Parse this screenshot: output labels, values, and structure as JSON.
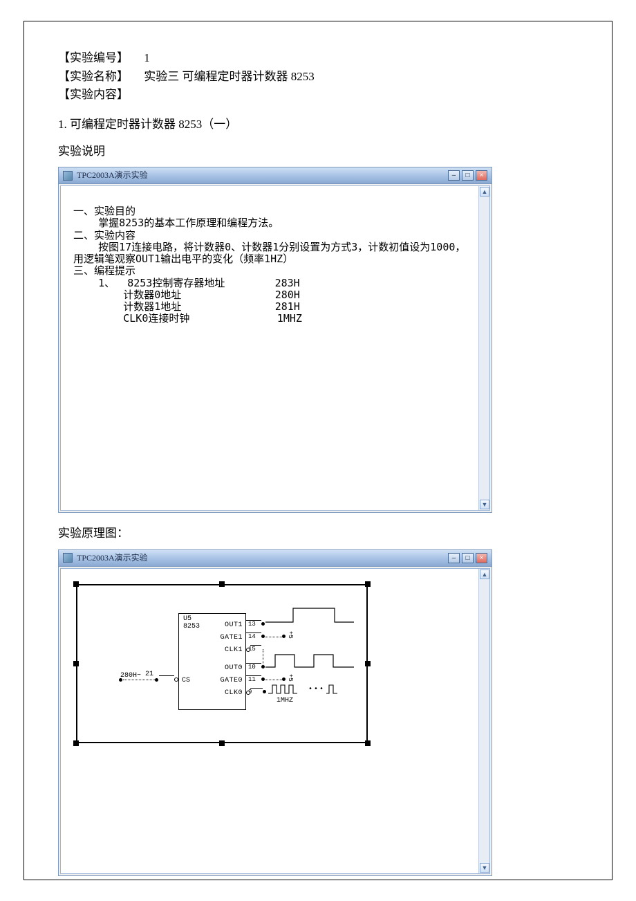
{
  "header": {
    "id_label": "【实验编号】",
    "id_value": "1",
    "name_label": "【实验名称】",
    "name_value": "实验三  可编程定时器计数器 8253",
    "content_label": "【实验内容】"
  },
  "section1_title": "1. 可编程定时器计数器 8253（一）",
  "desc_label": "实验说明",
  "win1": {
    "title": "TPC2003A演示实验",
    "text_lines": [
      "一、实验目的",
      "    掌握8253的基本工作原理和编程方法。",
      "二、实验内容",
      "    按图17连接电路，将计数器0、计数器1分别设置为方式3，计数初值设为1000，",
      "用逻辑笔观察OUT1输出电平的变化（频率1HZ）",
      "三、编程提示",
      "    1、  8253控制寄存器地址        283H",
      "        计数器0地址               280H",
      "        计数器1地址               281H",
      "        CLK0连接时钟              1MHZ"
    ]
  },
  "diagram_label": "实验原理图：",
  "win2": {
    "title": "TPC2003A演示实验",
    "chip_ref": "U5",
    "chip_name": "8253",
    "cs_label": "CS",
    "cs_pin": "21",
    "addr_label": "280H~",
    "pins_right": [
      {
        "name": "OUT1",
        "num": "13",
        "inv": false
      },
      {
        "name": "GATE1",
        "num": "14",
        "inv": false
      },
      {
        "name": "CLK1",
        "num": "15",
        "inv": true
      },
      {
        "name": "OUT0",
        "num": "10",
        "inv": false
      },
      {
        "name": "GATE0",
        "num": "11",
        "inv": false
      },
      {
        "name": "CLK0",
        "num": "9",
        "inv": true
      }
    ],
    "plus5_a": "+5",
    "plus5_b": "+5",
    "clk_freq": "1MHZ",
    "ellipsis": "•••"
  }
}
